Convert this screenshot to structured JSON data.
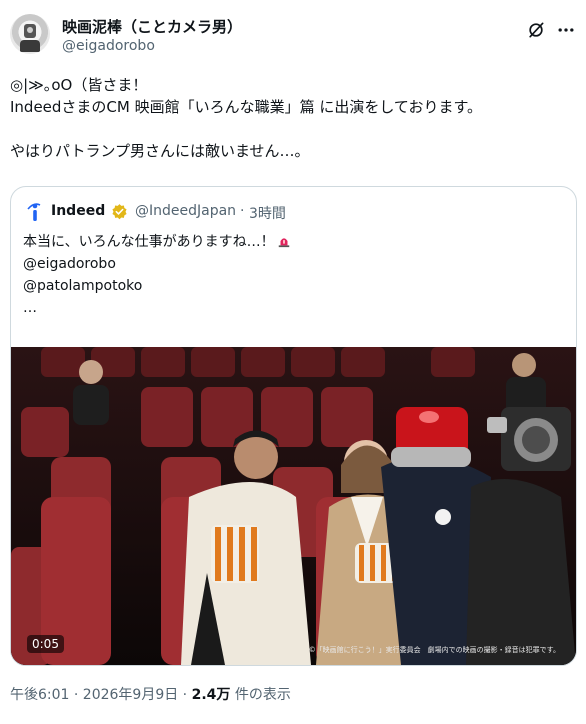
{
  "author": {
    "name": "映画泥棒（ことカメラ男）",
    "handle": "@eigadorobo"
  },
  "tweet": {
    "text": "◎|≫｡oO（皆さま！\nIndeedさまのCM 映画館「いろんな職業」篇 に出演をしております。\n\nやはりパトランプ男さんには敵いません…。"
  },
  "quoted": {
    "name": "Indeed",
    "handle": "@IndeedJapan",
    "separator": "·",
    "time": "3時間",
    "text": "本当に、いろんな仕事がありますね…！",
    "mentions": "@eigadorobo\n@patolampotoko\n…",
    "media": {
      "duration": "0:05",
      "caption": "©「映画館に行こう！」実行委員会　劇場内での映画の撮影・録音は犯罪です。"
    }
  },
  "footer": {
    "time": "午後6:01 · 2026年9月9日 · ",
    "views_count": "2.4万",
    "views_label": " 件の表示"
  },
  "icons": {
    "author_avatar": "camera-man-avatar",
    "grok": "grok-icon",
    "more": "more-icon",
    "quoted_avatar": "indeed-logo",
    "verified": "verified-gold-badge",
    "siren": "siren-emoji"
  },
  "colors": {
    "text": "#0f1419",
    "secondary": "#536471",
    "border": "#cfd9de",
    "verified_gold": "#e2b719",
    "indeed_blue": "#2164f3"
  }
}
